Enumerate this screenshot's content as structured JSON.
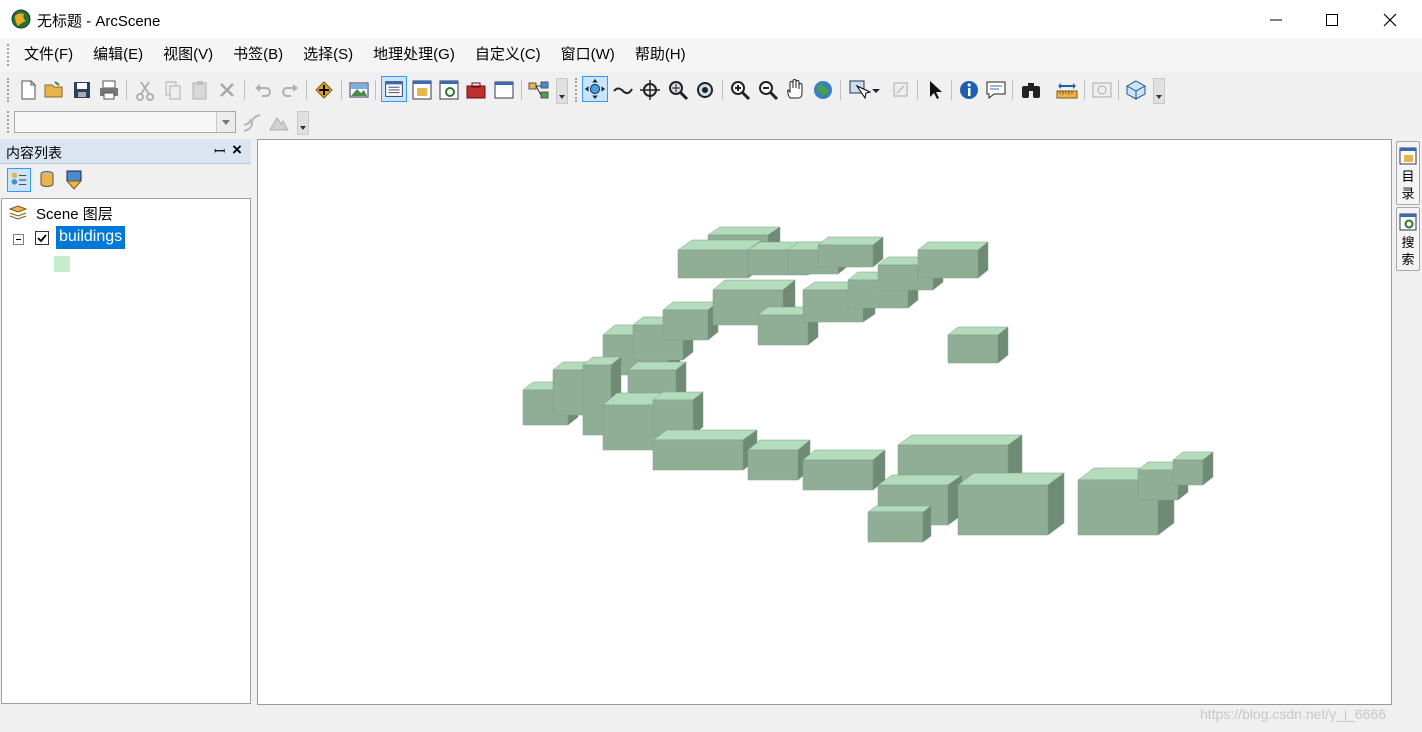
{
  "window": {
    "title": "无标题 - ArcScene",
    "app_icon": "arcscene-globe-icon"
  },
  "menu": [
    "文件(F)",
    "编辑(E)",
    "视图(V)",
    "书签(B)",
    "选择(S)",
    "地理处理(G)",
    "自定义(C)",
    "窗口(W)",
    "帮助(H)"
  ],
  "toc": {
    "title": "内容列表",
    "group_label": "Scene 图层",
    "layer": {
      "name": "buildings",
      "checked": true,
      "symbol_color": "#c4eccd"
    }
  },
  "dock": {
    "catalog_label": "目录",
    "search_label": "搜索"
  },
  "status": {
    "watermark": "https://blog.csdn.net/y_j_6666"
  },
  "colors": {
    "selection": "#0078d7",
    "building_top": "#b2dcbb",
    "building_front": "#90ae96",
    "building_side": "#6f8b75"
  }
}
